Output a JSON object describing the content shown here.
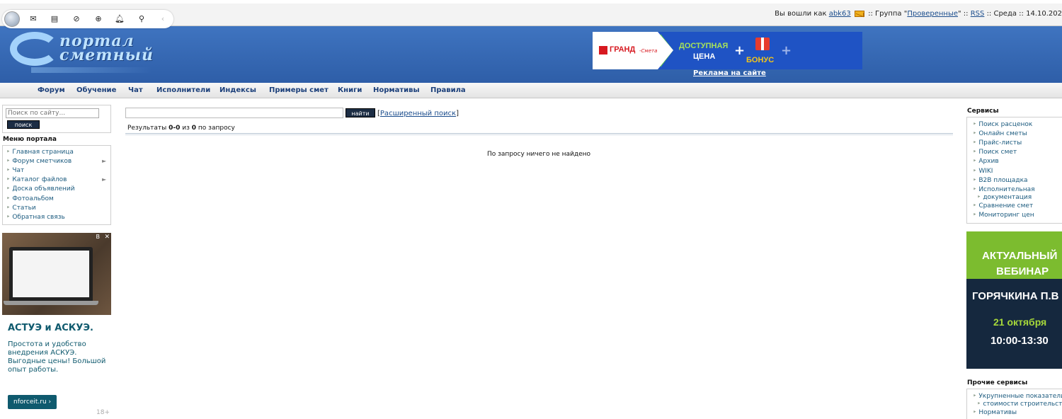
{
  "toolbar": {
    "icons": [
      "avatar",
      "mail-icon",
      "note-icon",
      "link-icon",
      "plus-circle-icon",
      "bell-icon",
      "search-icon",
      "chevron-left-icon"
    ]
  },
  "userbar": {
    "logged_in_as": "Вы вошли как",
    "username": "abk63",
    "group_sep": ":: Группа \"",
    "group": "Проверенные",
    "rss_sep": "\" ::",
    "rss": "RSS",
    "date": ":: Среда :: 14.10.202"
  },
  "header": {
    "logo_line1": "портал",
    "logo_line2": "сметный",
    "banner": {
      "brand": "ГРАНД",
      "brand_sub": "-Смета",
      "text1": "ДОСТУПНАЯ",
      "text2": "ЦЕНА",
      "plus": "+",
      "text3": "БОНУС"
    },
    "ad_link": "Реклама на сайте"
  },
  "nav": [
    "Форум",
    "Обучение",
    "Чат",
    "Исполнители",
    "Индексы",
    "Примеры смет",
    "Книги",
    "Нормативы",
    "Правила"
  ],
  "left": {
    "search_placeholder": "Поиск по сайту...",
    "search_button": "поиск",
    "menu_title": "Меню портала",
    "menu": [
      "Главная страница",
      "Форум сметчиков",
      "Чат",
      "Каталог файлов",
      "Доска объявлений",
      "Фотоальбом",
      "Статьи",
      "Обратная связь"
    ],
    "ad": {
      "badge": "В",
      "close": "✕",
      "title": "АСТУЭ и АСКУЭ.",
      "body": "Простота и удобство внедрения АСКУЭ. Выгодные цены! Большой опыт работы.",
      "button": "nforceit.ru ›",
      "age": "18+"
    }
  },
  "main": {
    "search_value": "",
    "search_button": "найти",
    "advanced_open": "[",
    "advanced": "Расширенный поиск",
    "advanced_close": "]",
    "results_prefix": "Результаты",
    "results_range": "0-0",
    "results_of": "из",
    "results_total": "0",
    "results_suffix": "по запросу",
    "no_results": "По запросу ничего не найдено"
  },
  "right": {
    "services_title": "Сервисы",
    "services": [
      "Поиск расценок",
      "Онлайн сметы",
      "Прайс-листы",
      "Поиск смет",
      "Архив",
      "WIKI",
      "B2B площадка",
      "Исполнительная",
      "документация",
      "Сравнение смет",
      "Мониторинг цен"
    ],
    "webinar": {
      "line1": "АКТУАЛЬНЫЙ",
      "line2": "ВЕБИНАР",
      "line3": "ГОРЯЧКИНА П.В",
      "line4": "21 октября",
      "line5": "10:00-13:30"
    },
    "other_title": "Прочие сервисы",
    "other": [
      "Укрупненные показатели",
      "стоимости строительства",
      "Нормативы"
    ]
  }
}
